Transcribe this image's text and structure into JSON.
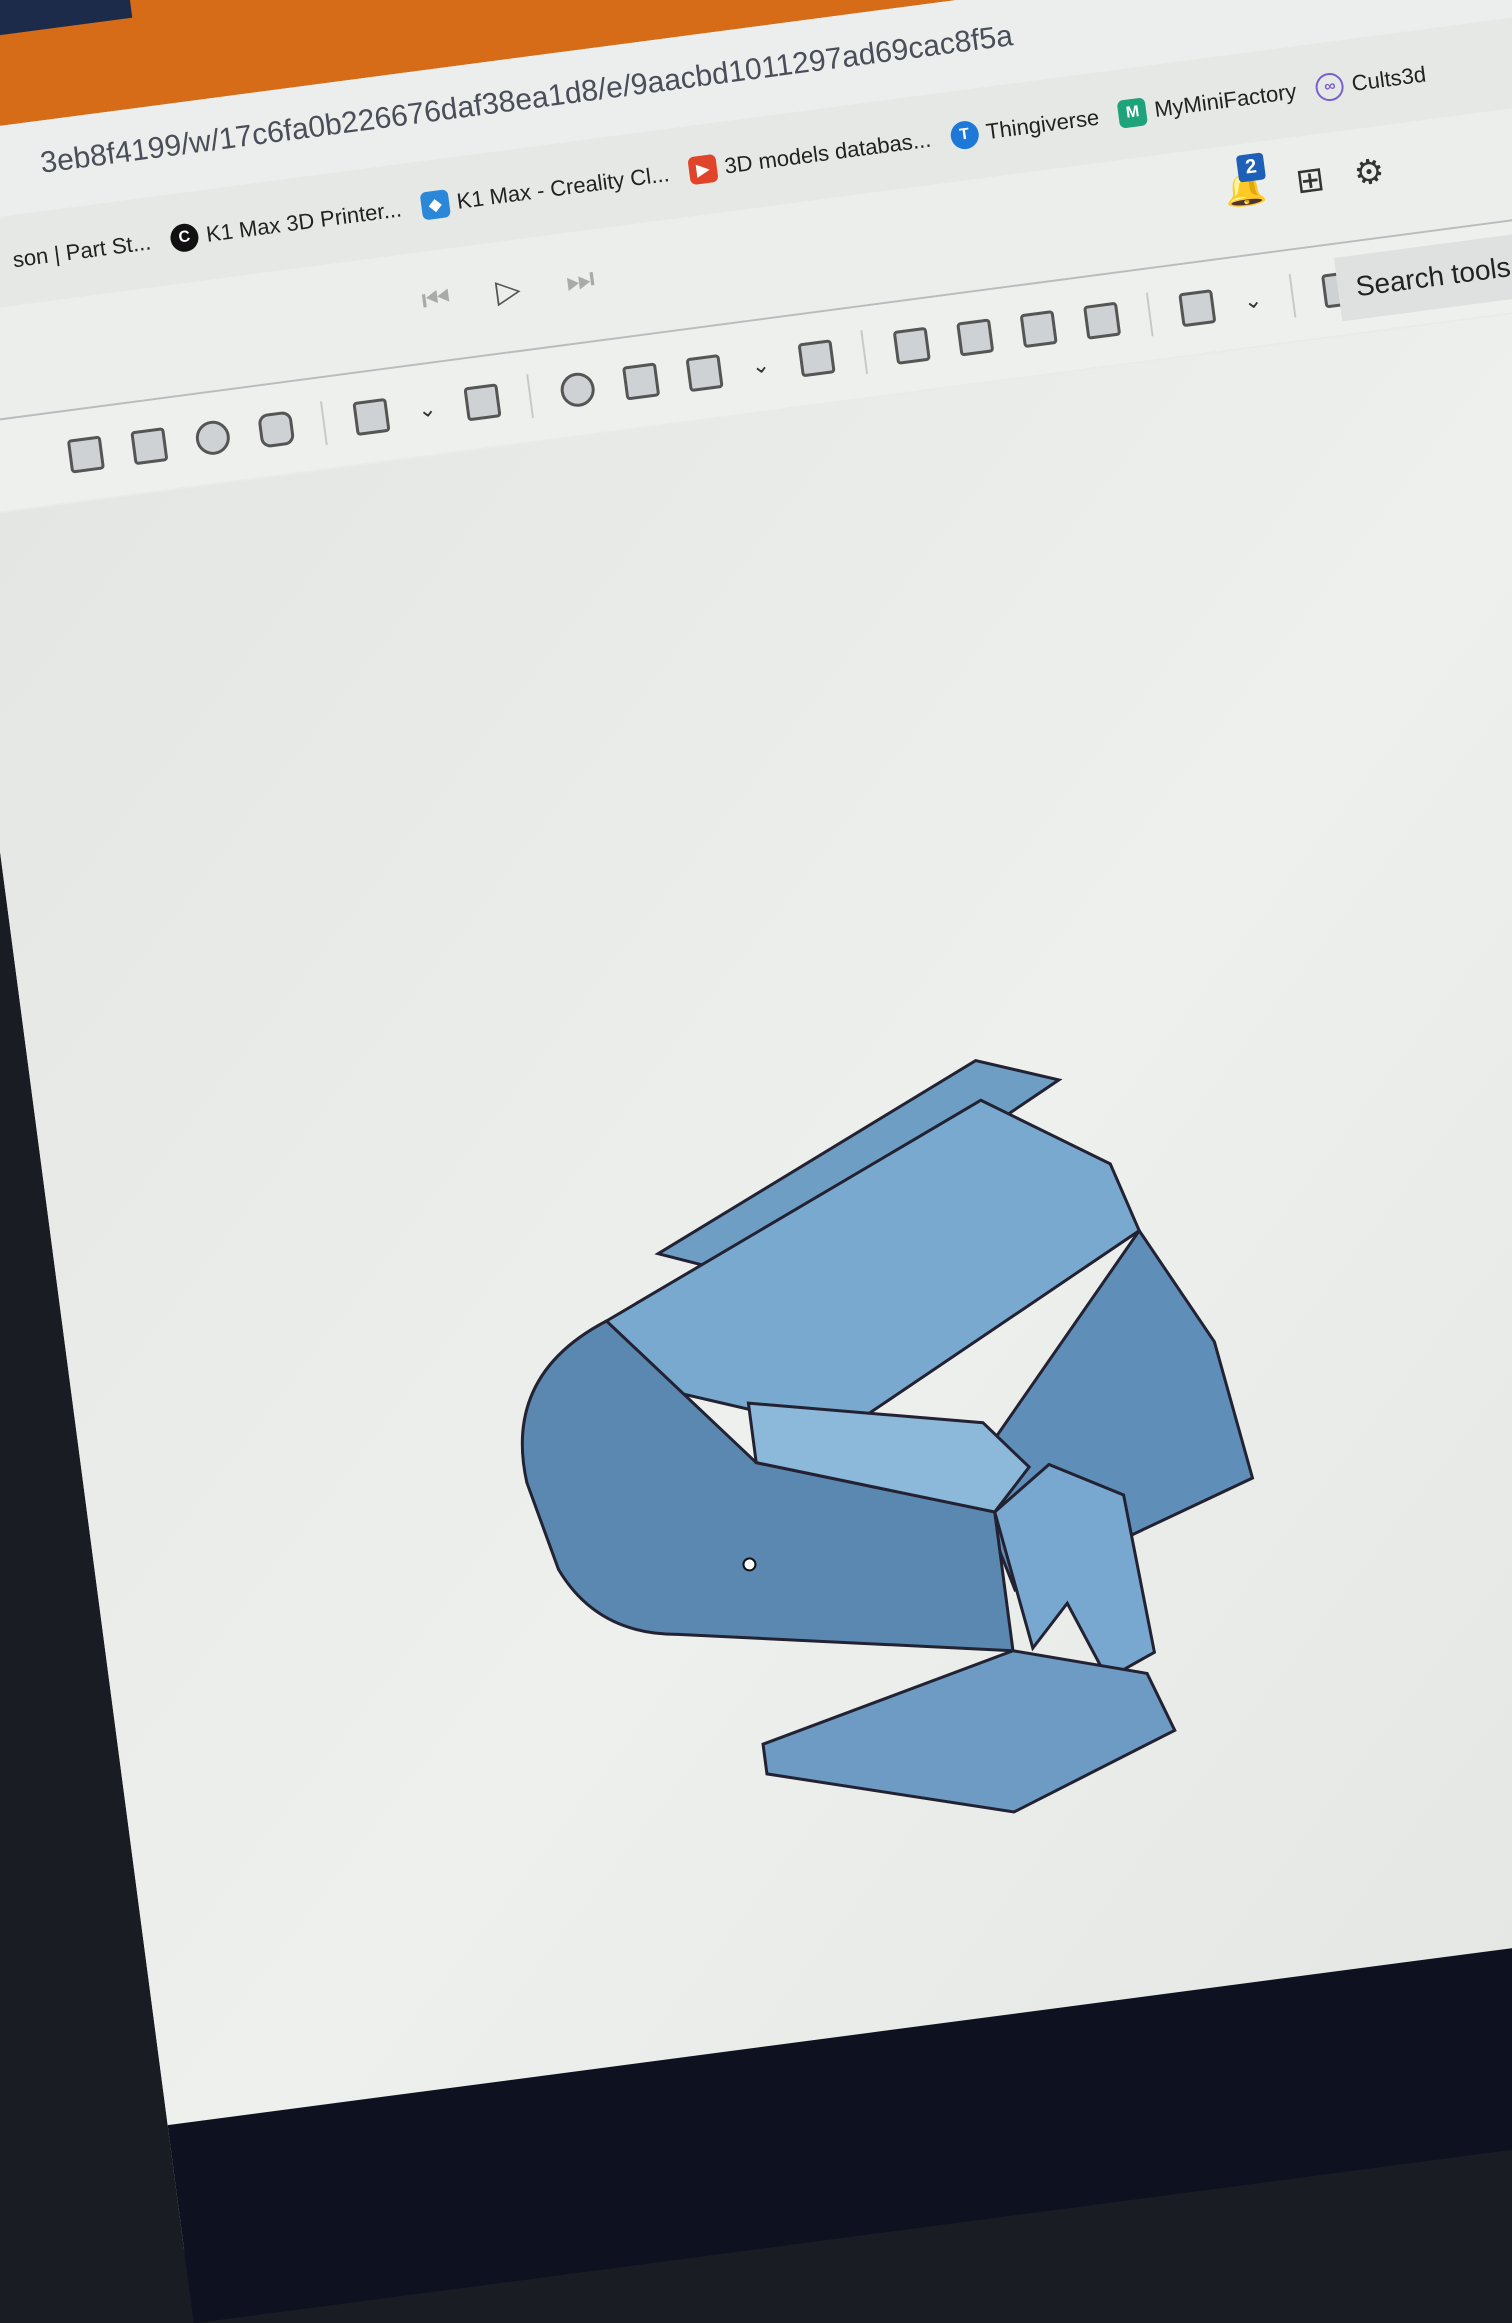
{
  "browser": {
    "url": "3eb8f4199/w/17c6fa0b226676daf38ea1d8/e/9aacbd1011297ad69cac8f5a",
    "bookmarks": [
      {
        "label": "son | Part St...",
        "icon": "none",
        "color": "#e6e8e6"
      },
      {
        "label": "K1 Max 3D Printer...",
        "icon": "creality-c-icon",
        "color": "#111111"
      },
      {
        "label": "K1 Max - Creality Cl...",
        "icon": "creality-cloud-icon",
        "color": "#2b88d8"
      },
      {
        "label": "3D models databas...",
        "icon": "printables-icon",
        "color": "#e0452b"
      },
      {
        "label": "Thingiverse",
        "icon": "thingiverse-icon",
        "color": "#1e78d8"
      },
      {
        "label": "MyMiniFactory",
        "icon": "myminifactory-icon",
        "color": "#1fa37a"
      },
      {
        "label": "Cults3d",
        "icon": "cults-icon",
        "color": "#7a5fd0"
      }
    ]
  },
  "app": {
    "notification_count": "2",
    "search_placeholder": "Search tools...",
    "accent": "#1e5fb8"
  }
}
